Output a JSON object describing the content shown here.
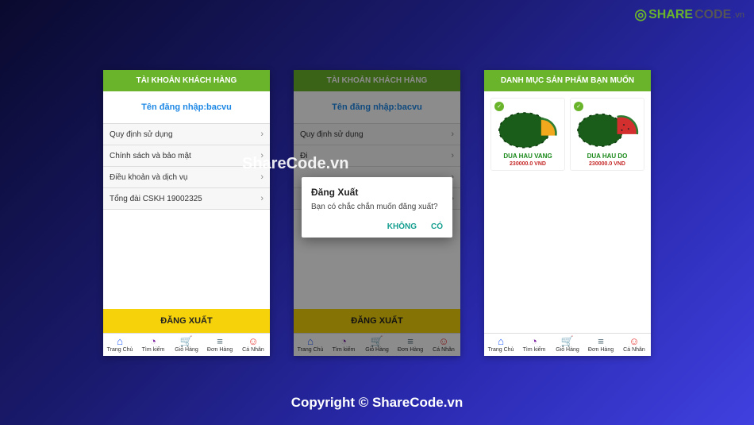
{
  "logo": {
    "share": "SHARE",
    "code": "CODE",
    "vn": ".vn"
  },
  "watermark_center": "ShareCode.vn",
  "copyright": "Copyright © ShareCode.vn",
  "screen1": {
    "header": "TÀI KHOẢN KHÁCH HÀNG",
    "login": "Tên đăng nhập:bacvu",
    "menu": [
      "Quy định sử dụng",
      "Chính sách và bảo mật",
      "Điều khoản và dịch vụ",
      "Tổng đài CSKH 19002325"
    ],
    "logout": "ĐĂNG XUẤT"
  },
  "screen2": {
    "header": "TÀI KHOẢN KHÁCH HÀNG",
    "login": "Tên đăng nhập:bacvu",
    "menu_visible": [
      "Quy định sử dụng"
    ],
    "logout": "ĐĂNG XUẤT",
    "dialog": {
      "title": "Đăng Xuất",
      "message": "Bạn có chắc chắn muốn đăng xuất?",
      "no": "KHÔNG",
      "yes": "CÓ"
    }
  },
  "screen3": {
    "header": "DANH MỤC SẢN PHẨM BẠN MUỐN",
    "products": [
      {
        "name": "DUA HAU VANG",
        "price": "230000.0 VND"
      },
      {
        "name": "DUA HAU DO",
        "price": "230000.0 VND"
      }
    ]
  },
  "tabs": {
    "home": "Trang Chủ",
    "search": "Tìm kiếm",
    "cart": "Giỏ Hàng",
    "order": "Đơn Hàng",
    "user": "Cá Nhân"
  }
}
